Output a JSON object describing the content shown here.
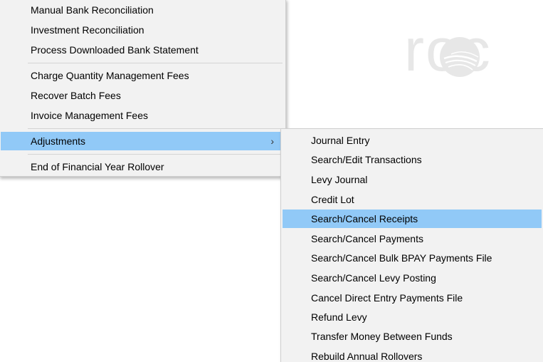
{
  "logo": {
    "text": "roc"
  },
  "main_menu": {
    "items": [
      {
        "label": "Manual Bank Reconciliation"
      },
      {
        "label": "Investment Reconciliation"
      },
      {
        "label": "Process Downloaded Bank Statement"
      },
      {
        "label": "Charge Quantity Management Fees"
      },
      {
        "label": "Recover Batch Fees"
      },
      {
        "label": "Invoice Management Fees"
      },
      {
        "label": "Adjustments",
        "submenu_arrow": "›",
        "highlighted": true
      },
      {
        "label": "End of Financial Year Rollover"
      }
    ]
  },
  "sub_menu": {
    "items": [
      {
        "label": "Journal Entry"
      },
      {
        "label": "Search/Edit Transactions"
      },
      {
        "label": "Levy Journal"
      },
      {
        "label": "Credit Lot"
      },
      {
        "label": "Search/Cancel Receipts",
        "highlighted": true
      },
      {
        "label": "Search/Cancel Payments"
      },
      {
        "label": "Search/Cancel Bulk BPAY Payments File"
      },
      {
        "label": "Search/Cancel Levy Posting"
      },
      {
        "label": "Cancel Direct Entry Payments File"
      },
      {
        "label": "Refund Levy"
      },
      {
        "label": "Transfer Money Between Funds"
      },
      {
        "label": "Rebuild Annual Rollovers"
      }
    ]
  },
  "colors": {
    "highlight": "#91c9f7",
    "menu_bg": "#f2f2f2",
    "logo": "#e7e7e7"
  }
}
